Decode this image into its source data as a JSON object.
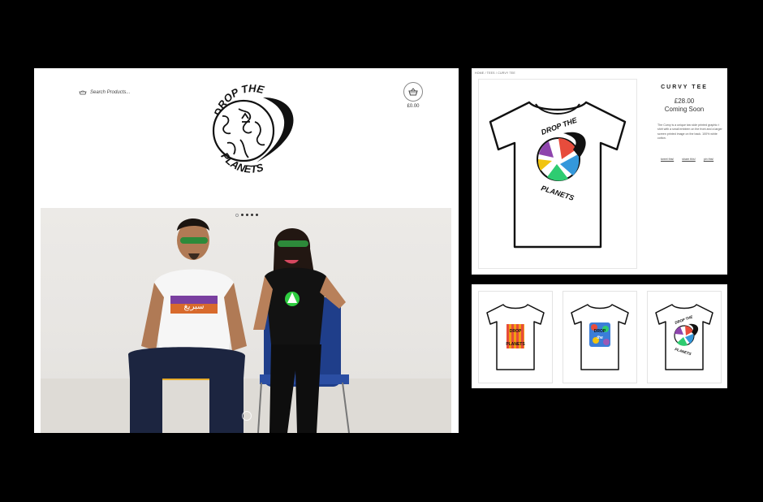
{
  "store": {
    "search_placeholder": "Search Products...",
    "cart_total": "£0.00",
    "logo_alt": "DROP THE PLANETS"
  },
  "hero": {
    "slides": 5,
    "active_slide": 0,
    "shirt_text": "سبريغ"
  },
  "product": {
    "breadcrumb": "HOME / TEES / CURVY TEE",
    "title": "CURVY TEE",
    "price": "£28.00",
    "status": "Coming Soon",
    "description": "The Curvy is a unique two side printed graphic t shirt with a small emblem on the front and a larger screen printed image on the back. 100% white cotton.",
    "share": [
      "tweet this!",
      "share this!",
      "pin this!"
    ]
  },
  "grid": {
    "items": [
      {
        "name": "drop-the-planets-stripes-tee",
        "text_top": "DROP",
        "text_bottom": "PLANETS"
      },
      {
        "name": "drop-the-planets-colour-tee",
        "text_top": "DROP",
        "text_bottom": "the"
      },
      {
        "name": "curvy-tee",
        "text_top": "DROP THE",
        "text_bottom": "PLANETS"
      }
    ]
  },
  "colors": {
    "background": "#000000",
    "panel": "#ffffff",
    "accent_green": "#2ecc40"
  }
}
